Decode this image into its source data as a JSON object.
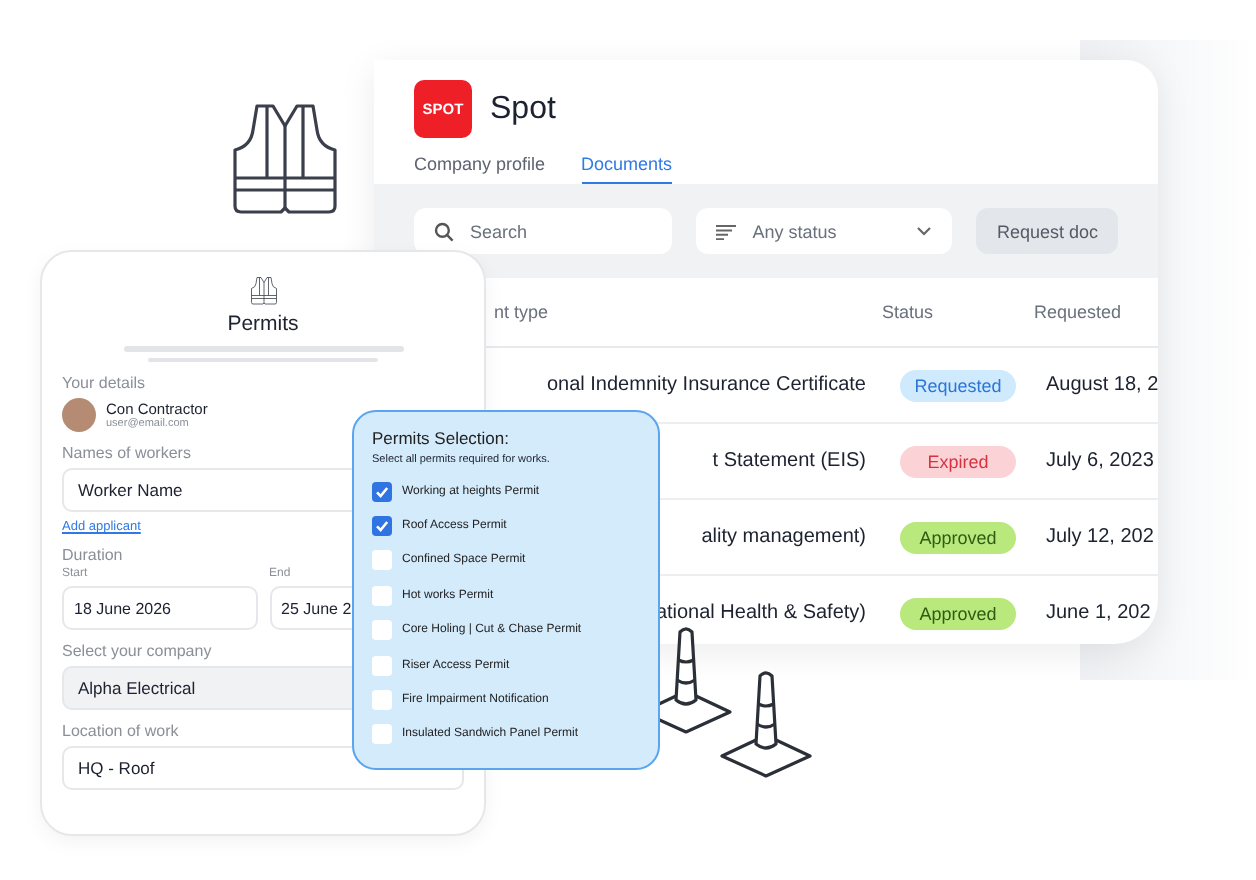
{
  "documents_window": {
    "logo": "SPOT",
    "title": "Spot",
    "tabs": [
      {
        "label": "Company profile",
        "selected": false
      },
      {
        "label": "Documents",
        "selected": true
      }
    ],
    "search": {
      "placeholder": "Search"
    },
    "status_filter": {
      "value": "Any status"
    },
    "request_button": "Request doc",
    "table": {
      "columns": [
        "nt type",
        "Status",
        "Requested"
      ],
      "rows": [
        {
          "document": "onal Indemnity Insurance Certificate",
          "status": "Requested",
          "kind": "requested",
          "requested": "August 18, 2"
        },
        {
          "document": "t Statement (EIS)",
          "status": "Expired",
          "kind": "expired",
          "requested": "July 6, 2023"
        },
        {
          "document": "ality management)",
          "status": "Approved",
          "kind": "approved",
          "requested": "July 12, 202"
        },
        {
          "document": "ational Health & Safety)",
          "status": "Approved",
          "kind": "approved",
          "requested": "June 1, 202"
        }
      ]
    }
  },
  "permits_form": {
    "title": "Permits",
    "your_details": {
      "label": "Your details",
      "name": "Con Contractor",
      "email": "user@email.com"
    },
    "workers": {
      "label": "Names of workers",
      "value": "Worker Name",
      "link": "Add applicant"
    },
    "duration": {
      "label": "Duration",
      "start_label": "Start",
      "start": "18 June 2026",
      "end_label": "End",
      "end": "25 June 2"
    },
    "company": {
      "label": "Select your company",
      "value": "Alpha Electrical"
    },
    "location": {
      "label": "Location of work",
      "value": "HQ - Roof"
    }
  },
  "permits_selection": {
    "title": "Permits Selection:",
    "subtitle": "Select all permits required for works.",
    "items": [
      {
        "label": "Working at heights Permit",
        "checked": true
      },
      {
        "label": "Roof Access Permit",
        "checked": true
      },
      {
        "label": "Confined Space Permit",
        "checked": false
      },
      {
        "label": "Hot works Permit",
        "checked": false
      },
      {
        "label": "Core Holing | Cut & Chase Permit",
        "checked": false
      },
      {
        "label": "Riser Access Permit",
        "checked": false
      },
      {
        "label": "Fire Impairment Notification",
        "checked": false
      },
      {
        "label": "Insulated Sandwich Panel Permit",
        "checked": false
      }
    ]
  }
}
